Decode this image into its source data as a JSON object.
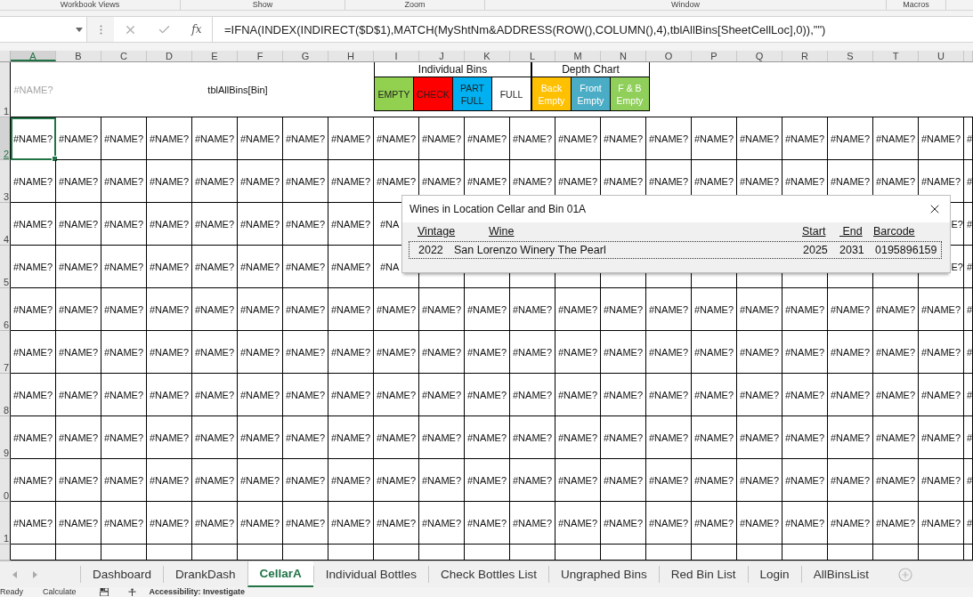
{
  "ribbon_groups": [
    "Workbook Views",
    "Show",
    "Zoom",
    "Window",
    "Macros"
  ],
  "formula_bar": {
    "function_label": "fx",
    "formula": "=IFNA(INDEX(INDIRECT($D$1),MATCH(MyShtNm&ADDRESS(ROW(),COLUMN(),4),tblAllBins[SheetCellLoc],0)),\"\")"
  },
  "columns": [
    {
      "label": "A",
      "selected": true
    },
    {
      "label": "B",
      "selected": false
    },
    {
      "label": "C",
      "selected": false
    },
    {
      "label": "D",
      "selected": false
    },
    {
      "label": "E",
      "selected": false
    },
    {
      "label": "F",
      "selected": false
    },
    {
      "label": "G",
      "selected": false
    },
    {
      "label": "H",
      "selected": false
    },
    {
      "label": "I",
      "selected": false
    },
    {
      "label": "J",
      "selected": false
    },
    {
      "label": "K",
      "selected": false
    },
    {
      "label": "L",
      "selected": false
    },
    {
      "label": "M",
      "selected": false
    },
    {
      "label": "N",
      "selected": false
    },
    {
      "label": "O",
      "selected": false
    },
    {
      "label": "P",
      "selected": false
    },
    {
      "label": "Q",
      "selected": false
    },
    {
      "label": "R",
      "selected": false
    },
    {
      "label": "S",
      "selected": false
    },
    {
      "label": "T",
      "selected": false
    },
    {
      "label": "U",
      "selected": false
    }
  ],
  "header_row": {
    "number": "1",
    "cell_a": "#NAME?",
    "title": "tblAllBins[Bin]",
    "legend": [
      {
        "heading": "Individual Bins",
        "items": [
          {
            "label": "EMPTY",
            "color": "#92d050"
          },
          {
            "label": "CHECK",
            "color": "#ff0000"
          },
          {
            "label": "PART FULL",
            "color": "#00b0f0"
          },
          {
            "label": "FULL",
            "color": "#ffffff"
          }
        ]
      },
      {
        "heading": "Depth Chart",
        "items": [
          {
            "label": "Back Empty",
            "color": "#ffc000"
          },
          {
            "label": "Front Empty",
            "color": "#4bacc6"
          },
          {
            "label": "F & B Empty",
            "color": "#8fcf5a"
          }
        ]
      }
    ]
  },
  "rows": [
    {
      "number": "2",
      "selected": true,
      "cells": [
        "#NAME?",
        "#NAME?",
        "#NAME?",
        "#NAME?",
        "#NAME?",
        "#NAME?",
        "#NAME?",
        "#NAME?",
        "#NAME?",
        "#NAME?",
        "#NAME?",
        "#NAME?",
        "#NAME?",
        "#NAME?",
        "#NAME?",
        "#NAME?",
        "#NAME?",
        "#NAME?",
        "#NAME?",
        "#NAME?",
        "#NAME?",
        "#"
      ]
    },
    {
      "number": "3",
      "selected": false,
      "cells": [
        "#NAME?",
        "#NAME?",
        "#NAME?",
        "#NAME?",
        "#NAME?",
        "#NAME?",
        "#NAME?",
        "#NAME?",
        "#NAME?",
        "#NAME?",
        "#NAME?",
        "#NAME?",
        "#NAME?",
        "#NAME?",
        "#NAME?",
        "#NAME?",
        "#NAME?",
        "#NAME?",
        "#NAME?",
        "#NAME?",
        "#NAME?",
        "#"
      ]
    },
    {
      "number": "4",
      "selected": false,
      "cells": [
        "#NAME?",
        "#NAME?",
        "#NAME?",
        "#NAME?",
        "#NAME?",
        "#NAME?",
        "#NAME?",
        "#NAME?",
        "#NA",
        null,
        null,
        null,
        null,
        null,
        null,
        null,
        null,
        null,
        null,
        null,
        "E?",
        "#"
      ]
    },
    {
      "number": "5",
      "selected": false,
      "cells": [
        "#NAME?",
        "#NAME?",
        "#NAME?",
        "#NAME?",
        "#NAME?",
        "#NAME?",
        "#NAME?",
        "#NAME?",
        "#NA",
        null,
        null,
        null,
        null,
        null,
        null,
        null,
        null,
        null,
        null,
        null,
        "E?",
        "#"
      ]
    },
    {
      "number": "6",
      "selected": false,
      "cells": [
        "#NAME?",
        "#NAME?",
        "#NAME?",
        "#NAME?",
        "#NAME?",
        "#NAME?",
        "#NAME?",
        "#NAME?",
        "#NAME?",
        "#NAME?",
        "#NAME?",
        "#NAME?",
        "#NAME?",
        "#NAME?",
        "#NAME?",
        "#NAME?",
        "#NAME?",
        "#NAME?",
        "#NAME?",
        "#NAME?",
        "#NAME?",
        "#"
      ]
    },
    {
      "number": "7",
      "selected": false,
      "cells": [
        "#NAME?",
        "#NAME?",
        "#NAME?",
        "#NAME?",
        "#NAME?",
        "#NAME?",
        "#NAME?",
        "#NAME?",
        "#NAME?",
        "#NAME?",
        "#NAME?",
        "#NAME?",
        "#NAME?",
        "#NAME?",
        "#NAME?",
        "#NAME?",
        "#NAME?",
        "#NAME?",
        "#NAME?",
        "#NAME?",
        "#NAME?",
        "#"
      ]
    },
    {
      "number": "8",
      "selected": false,
      "cells": [
        "#NAME?",
        "#NAME?",
        "#NAME?",
        "#NAME?",
        "#NAME?",
        "#NAME?",
        "#NAME?",
        "#NAME?",
        "#NAME?",
        "#NAME?",
        "#NAME?",
        "#NAME?",
        "#NAME?",
        "#NAME?",
        "#NAME?",
        "#NAME?",
        "#NAME?",
        "#NAME?",
        "#NAME?",
        "#NAME?",
        "#NAME?",
        "#"
      ]
    },
    {
      "number": "9",
      "selected": false,
      "cells": [
        "#NAME?",
        "#NAME?",
        "#NAME?",
        "#NAME?",
        "#NAME?",
        "#NAME?",
        "#NAME?",
        "#NAME?",
        "#NAME?",
        "#NAME?",
        "#NAME?",
        "#NAME?",
        "#NAME?",
        "#NAME?",
        "#NAME?",
        "#NAME?",
        "#NAME?",
        "#NAME?",
        "#NAME?",
        "#NAME?",
        "#NAME?",
        "#"
      ]
    },
    {
      "number": "0",
      "selected": false,
      "cells": [
        "#NAME?",
        "#NAME?",
        "#NAME?",
        "#NAME?",
        "#NAME?",
        "#NAME?",
        "#NAME?",
        "#NAME?",
        "#NAME?",
        "#NAME?",
        "#NAME?",
        "#NAME?",
        "#NAME?",
        "#NAME?",
        "#NAME?",
        "#NAME?",
        "#NAME?",
        "#NAME?",
        "#NAME?",
        "#NAME?",
        "#NAME?",
        "#"
      ]
    },
    {
      "number": "1",
      "selected": false,
      "cells": [
        "#NAME?",
        "#NAME?",
        "#NAME?",
        "#NAME?",
        "#NAME?",
        "#NAME?",
        "#NAME?",
        "#NAME?",
        "#NAME?",
        "#NAME?",
        "#NAME?",
        "#NAME?",
        "#NAME?",
        "#NAME?",
        "#NAME?",
        "#NAME?",
        "#NAME?",
        "#NAME?",
        "#NAME?",
        "#NAME?",
        "#NAME?",
        "#"
      ]
    }
  ],
  "dialog": {
    "title": "Wines in Location Cellar and Bin 01A",
    "columns": [
      "Vintage",
      "Wine",
      "Start",
      " End",
      "Barcode"
    ],
    "rows": [
      {
        "focused": true,
        "cells": [
          "2022",
          "San Lorenzo Winery The Pearl",
          "2025",
          "2031",
          "0195896159"
        ]
      }
    ]
  },
  "sheet_tabs": [
    {
      "label": "Dashboard",
      "selected": false
    },
    {
      "label": "DrankDash",
      "selected": false
    },
    {
      "label": "CellarA",
      "selected": true
    },
    {
      "label": "Individual Bottles",
      "selected": false
    },
    {
      "label": "Check Bottles List",
      "selected": false
    },
    {
      "label": "Ungraphed Bins",
      "selected": false
    },
    {
      "label": "Red Bin List",
      "selected": false
    },
    {
      "label": "Login",
      "selected": false
    },
    {
      "label": "AllBinsList",
      "selected": false
    }
  ],
  "status_bar": {
    "mode": "Ready",
    "calculation": "Calculate",
    "accessibility": "Accessibility: Investigate"
  }
}
